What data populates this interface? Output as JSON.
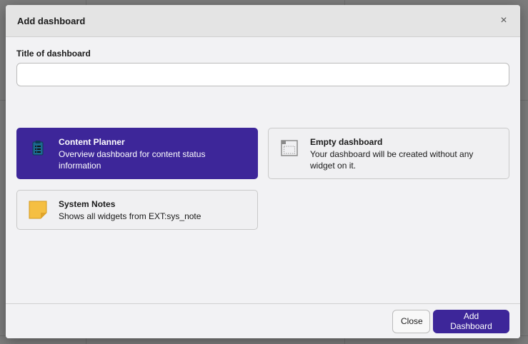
{
  "modal": {
    "title": "Add dashboard",
    "close_glyph": "×"
  },
  "form": {
    "title_label": "Title of dashboard",
    "title_value": "",
    "title_placeholder": ""
  },
  "presets": [
    {
      "title": "Content Planner",
      "description": "Overview dashboard for content status information",
      "icon": "clipboard-icon",
      "selected": true
    },
    {
      "title": "Empty dashboard",
      "description": "Your dashboard will be created without any widget on it.",
      "icon": "empty-dashboard-icon",
      "selected": false
    },
    {
      "title": "System Notes",
      "description": "Shows all widgets from EXT:sys_note",
      "icon": "sticky-note-icon",
      "selected": false
    }
  ],
  "footer": {
    "close_label": "Close",
    "add_label": "Add Dashboard"
  },
  "colors": {
    "accent": "#3d2699",
    "note_yellow": "#f5bf42"
  }
}
